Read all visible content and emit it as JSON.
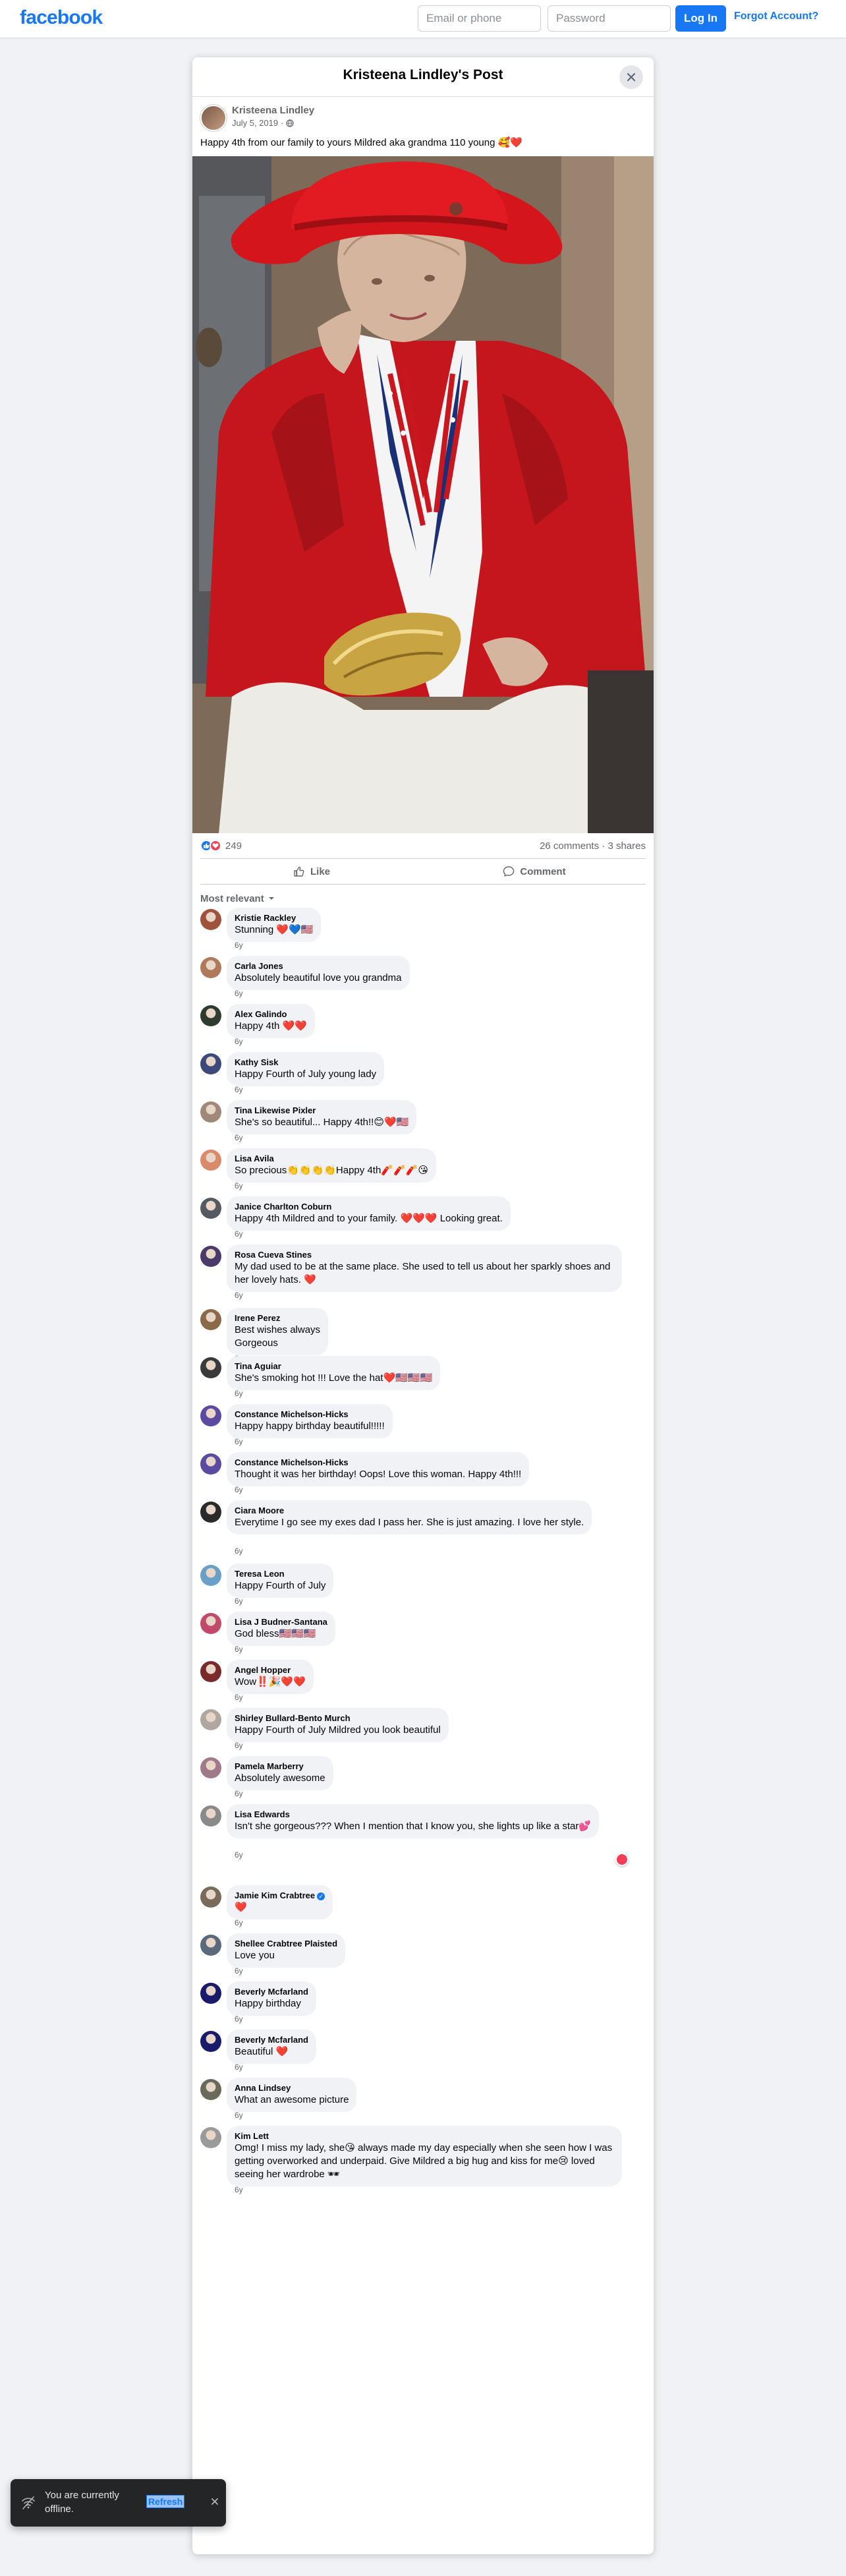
{
  "topbar": {
    "logo": "facebook",
    "email_placeholder": "Email or phone",
    "password_placeholder": "Password",
    "login_label": "Log In",
    "forgot_label": "Forgot Account?"
  },
  "dialog": {
    "title": "Kristeena Lindley's Post",
    "close_icon": "close-icon"
  },
  "post": {
    "author": "Kristeena Lindley",
    "date": "July 5, 2019",
    "separator": "·",
    "privacy_icon": "globe-icon",
    "text": "Happy 4th from our family to yours Mildred aka grandma 110 young 🥰❤️",
    "reaction_count": "249",
    "comments_count": "26 comments",
    "shares_count": "3 shares",
    "like_label": "Like",
    "comment_label": "Comment",
    "sort_label": "Most relevant"
  },
  "comments": [
    {
      "name": "Kristie Rackley",
      "text": "Stunning ❤️💙🇺🇸",
      "time": "6y",
      "color": "#a0523d"
    },
    {
      "name": "Carla Jones",
      "text": "Absolutely beautiful love you grandma",
      "time": "6y",
      "color": "#b07a5a"
    },
    {
      "name": "Alex Galindo",
      "text": "Happy 4th ❤️❤️",
      "time": "6y",
      "color": "#2f3b2f"
    },
    {
      "name": "Kathy Sisk",
      "text": "Happy Fourth of July young lady",
      "time": "6y",
      "color": "#3b4a7a"
    },
    {
      "name": "Tina Likewise Pixler",
      "text": "She's so beautiful... Happy 4th!!😊❤️🇺🇸",
      "time": "6y",
      "color": "#a08878"
    },
    {
      "name": "Lisa Avila",
      "text": "So precious👏👏👏👏Happy 4th🧨🧨🧨😘",
      "time": "6y",
      "color": "#d98a6a"
    },
    {
      "name": "Janice Charlton Coburn",
      "text": "Happy 4th Mildred and to your family. ❤️❤️❤️ Looking great.",
      "time": "6y",
      "color": "#555a60"
    },
    {
      "name": "Rosa Cueva Stines",
      "text": "My dad used to be at the same place. She used to tell us about her sparkly shoes and her lovely hats. ❤️",
      "time": "6y",
      "color": "#4a3a6a"
    },
    {
      "name": "Irene Perez",
      "text": "Best wishes always\nGorgeous",
      "time": "6y",
      "color": "#8a6a4a"
    },
    {
      "name": "Tina Aguiar",
      "text": "She's smoking hot !!! Love the hat❤️🇺🇸🇺🇸🇺🇸",
      "time": "6y",
      "color": "#3a3a3a"
    },
    {
      "name": "Constance Michelson-Hicks",
      "text": "Happy happy birthday beautiful!!!!!",
      "time": "6y",
      "color": "#5a4aa0"
    },
    {
      "name": "Constance Michelson-Hicks",
      "text": "Thought it was her birthday! Oops! Love this woman. Happy 4th!!!",
      "time": "6y",
      "color": "#5a4aa0"
    },
    {
      "name": "Ciara Moore",
      "text": "Everytime I go see my exes dad I pass her. She is just amazing. I love her style.",
      "time": "6y",
      "color": "#2a2a2a"
    },
    {
      "name": "Teresa Leon",
      "text": "Happy Fourth of July",
      "time": "6y",
      "color": "#6aa0c8"
    },
    {
      "name": "Lisa J Budner-Santana",
      "text": "God bless🇺🇸🇺🇸🇺🇸",
      "time": "6y",
      "color": "#c04a6a"
    },
    {
      "name": "Angel Hopper",
      "text": "Wow‼️🎉❤️❤️",
      "time": "6y",
      "color": "#7a2a2a"
    },
    {
      "name": "Shirley Bullard-Bento Murch",
      "text": "Happy Fourth of July Mildred you look beautiful",
      "time": "6y",
      "color": "#b0a8a0"
    },
    {
      "name": "Pamela Marberry",
      "text": "Absolutely awesome",
      "time": "6y",
      "color": "#a07a8a"
    },
    {
      "name": "Lisa Edwards",
      "text": "Isn't she gorgeous??? When I mention that I know you, she lights up like a star💕",
      "time": "6y",
      "color": "#8a8a8a"
    },
    {
      "name": "Jamie Kim Crabtree",
      "text": "❤️",
      "time": "6y",
      "color": "#7a6a5a",
      "verified": true
    },
    {
      "name": "Shellee Crabtree Plaisted",
      "text": "Love you",
      "time": "6y",
      "color": "#5a6a7a"
    },
    {
      "name": "Beverly Mcfarland",
      "text": "Happy birthday",
      "time": "6y",
      "color": "#1a1a6a"
    },
    {
      "name": "Beverly Mcfarland",
      "text": "Beautiful ❤️",
      "time": "6y",
      "color": "#1a1a6a"
    },
    {
      "name": "Anna Lindsey",
      "text": "What an awesome picture",
      "time": "6y",
      "color": "#6a6a5a"
    },
    {
      "name": "Kim Lett",
      "text": "Omg! I miss my lady, she😘 always made my day especially when she seen how I was getting overworked and underpaid. Give Mildred a big hug and kiss for me😢 loved seeing her wardrobe 🕶",
      "time": "6y",
      "color": "#9a9a9a"
    }
  ],
  "toast": {
    "text": "You are currently offline.",
    "refresh_label": "Refresh",
    "icon": "wifi-off-icon",
    "close_icon": "close-icon"
  }
}
